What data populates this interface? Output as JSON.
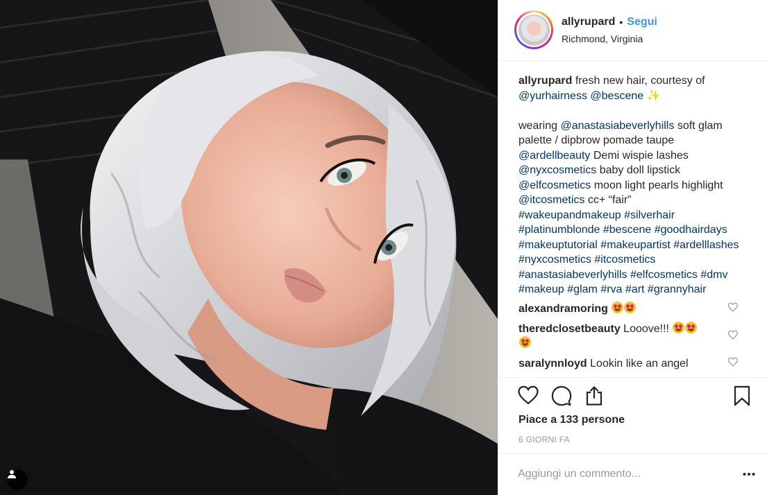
{
  "post": {
    "image_alt": "selfie photo with silver platinum hair"
  },
  "header": {
    "username": "allyrupard",
    "separator": "•",
    "follow_label": "Segui",
    "location": "Richmond, Virginia"
  },
  "caption": {
    "username": "allyrupard",
    "intro": "fresh new hair, courtesy of",
    "mention_1": "@yurhairness",
    "mention_2": "@bescene",
    "sparkle": "✨",
    "line_1": {
      "mention": "@anastasiabeverlyhills",
      "text": "soft glam palette / dipbrow pomade taupe"
    },
    "line_2": {
      "mention": "@ardellbeauty",
      "text": "Demi wispie lashes"
    },
    "line_3": {
      "mention": "@nyxcosmetics",
      "text": "baby doll lipstick"
    },
    "line_4": {
      "mention": "@elfcosmetics",
      "text": "moon light pearls highlight"
    },
    "line_5": {
      "mention": "@itcosmetics",
      "text": "cc+ “fair”"
    },
    "intro_wearing": "wearing",
    "hashtags": [
      "#wakeupandmakeup",
      "#silverhair",
      "#platinumblonde",
      "#bescene",
      "#goodhairdays",
      "#makeuptutorial",
      "#makeupartist",
      "#ardelllashes",
      "#nyxcosmetics",
      "#itcosmetics",
      "#anastasiabeverlyhills",
      "#elfcosmetics",
      "#dmv",
      "#makeup",
      "#glam",
      "#rva",
      "#art",
      "#grannyhair"
    ]
  },
  "comments": [
    {
      "user": "alexandramoring",
      "text": "",
      "emoji_count": 2
    },
    {
      "user": "theredclosetbeauty",
      "text": "Looove!!!",
      "emoji_count": 3
    },
    {
      "user": "saralynnloyd",
      "text": "Lookin like an angel",
      "emoji_count": 0
    }
  ],
  "actions": {
    "icons": [
      "heart-icon",
      "comment-icon",
      "share-icon",
      "bookmark-icon"
    ],
    "likes_label": "Piace a 133 persone",
    "time_ago": "6 GIORNI FA"
  },
  "add_comment": {
    "placeholder": "Aggiungi un commento...",
    "more_icon": "ellipsis-icon"
  },
  "colors": {
    "link": "#003569",
    "follow": "#3897f0",
    "muted": "#999999",
    "border": "#efefef"
  }
}
